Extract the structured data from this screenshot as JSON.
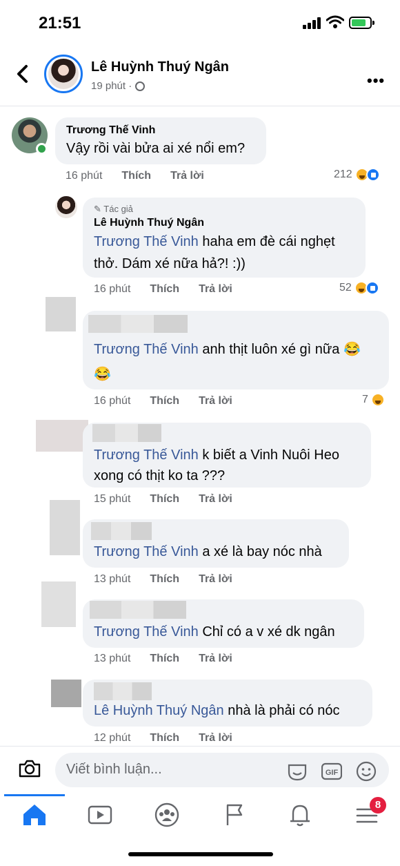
{
  "status_bar": {
    "time": "21:51"
  },
  "post_header": {
    "name": "Lê Huỳnh Thuý Ngân",
    "time": "19 phút ·"
  },
  "comments": [
    {
      "author": "Trương Thế Vinh",
      "text": "Vậy rồi vài bửa ai xé nổi em?",
      "time": "16 phút",
      "like": "Thích",
      "reply": "Trả lời",
      "reactions": "212"
    },
    {
      "tag": "Tác giả",
      "author": "Lê Huỳnh Thuý Ngân",
      "mention": "Trương Thế Vinh",
      "text": " haha em đè cái nghẹt thở. Dám xé nữa hả?! :))",
      "time": "16 phút",
      "like": "Thích",
      "reply": "Trả lời",
      "reactions": "52"
    },
    {
      "mention": "Trương Thế Vinh",
      "text": " anh thịt luôn xé gì nữa",
      "time": "16 phút",
      "like": "Thích",
      "reply": "Trả lời",
      "reactions": "7"
    },
    {
      "mention": "Trương Thế Vinh",
      "text": " k biết a Vinh Nuôi Heo xong có thịt ko ta ???",
      "time": "15 phút",
      "like": "Thích",
      "reply": "Trả lời"
    },
    {
      "mention": "Trương Thế Vinh",
      "text": " a xé là bay nóc nhà",
      "time": "13 phút",
      "like": "Thích",
      "reply": "Trả lời"
    },
    {
      "mention": "Trương Thế Vinh",
      "text": " Chỉ có a v xé dk ngân",
      "time": "13 phút",
      "like": "Thích",
      "reply": "Trả lời"
    },
    {
      "mention": "Lê Huỳnh Thuý Ngân",
      "text": " nhà là phải có nóc",
      "time": "12 phút",
      "like": "Thích",
      "reply": "Trả lời"
    }
  ],
  "composer": {
    "placeholder": "Viết bình luận..."
  },
  "nav": {
    "badge": "8"
  },
  "colors": {
    "accent": "#1877f2",
    "mention": "#385898",
    "bubble": "#f0f2f5",
    "online": "#31a24c"
  }
}
